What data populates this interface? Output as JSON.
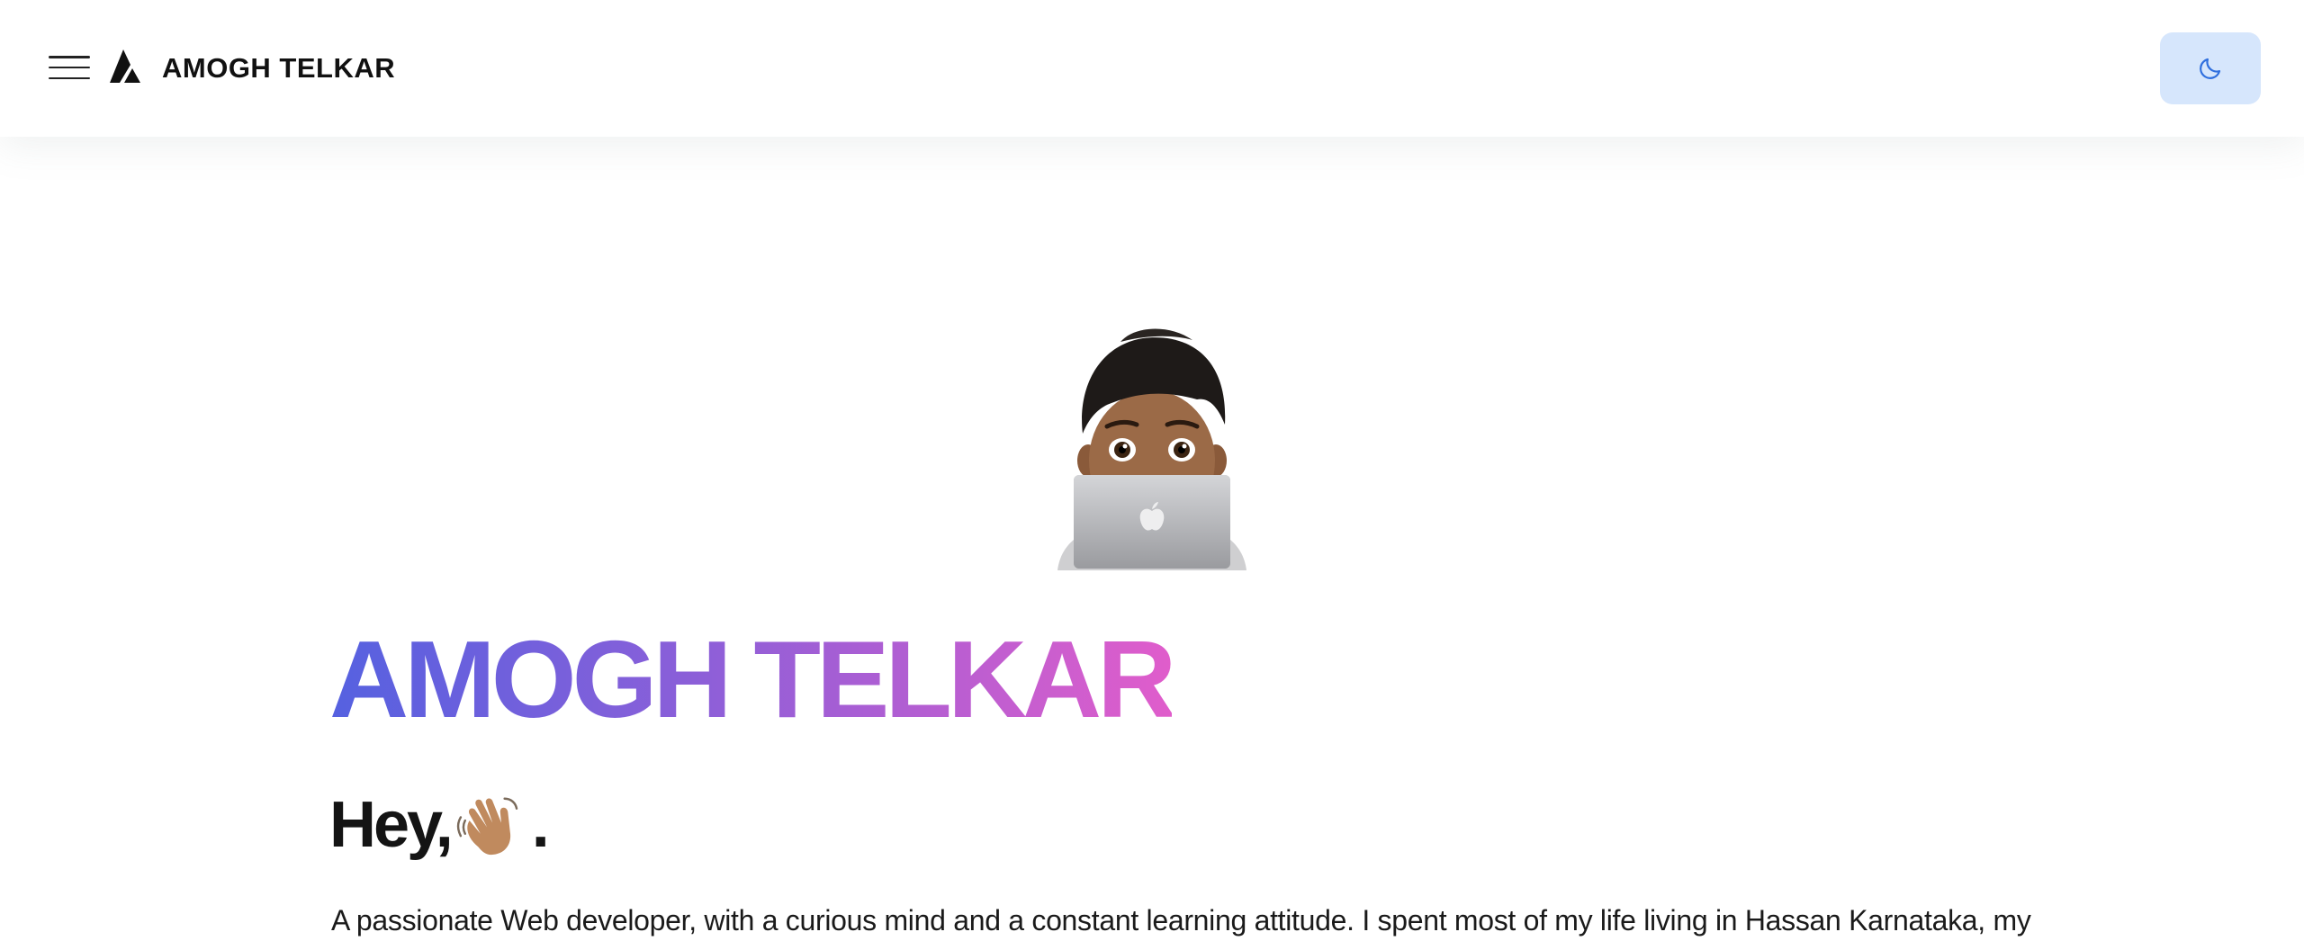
{
  "header": {
    "brand": "AMOGH TELKAR",
    "menu_icon": "hamburger-menu-icon",
    "logo_icon": "triangle-logo-icon",
    "theme_toggle_icon": "moon-icon",
    "theme_toggle_bg": "#d6e6fc",
    "theme_toggle_icon_color": "#2f6fde"
  },
  "hero": {
    "avatar_icon": "memoji-laptop-avatar",
    "title": "AMOGH TELKAR",
    "title_gradient": [
      "#5561e0",
      "#8e5fd8",
      "#e05dcb"
    ],
    "greeting_prefix": "Hey,",
    "greeting_icon": "waving-hand-icon",
    "greeting_suffix": ".",
    "intro": "A passionate Web developer, with a curious mind and a constant learning attitude. I spent most of my life living in Hassan Karnataka, my"
  }
}
